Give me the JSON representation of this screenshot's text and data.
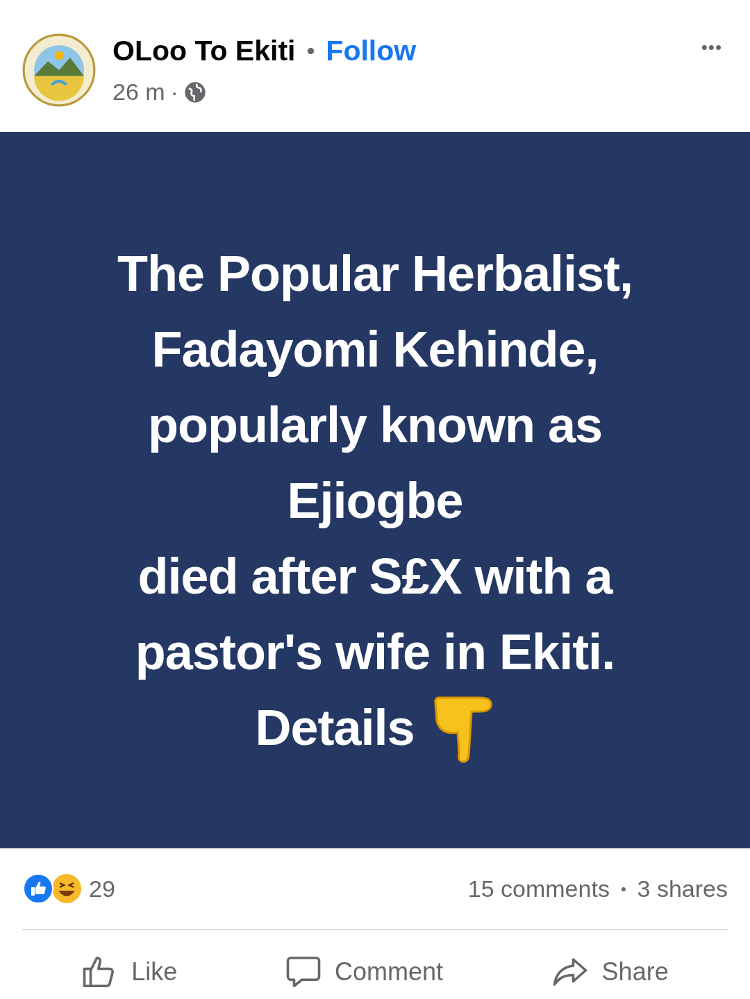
{
  "post": {
    "author": "OLoo To Ekiti",
    "separator": "•",
    "follow": "Follow",
    "time": "26 m",
    "time_separator": "·",
    "menu": "•••",
    "card_lines": [
      "The Popular Herbalist,",
      "Fadayomi Kehinde,",
      "popularly known as",
      "Ejiogbe",
      "died after S£X with a",
      "pastor's wife in Ekiti."
    ],
    "card_last_line": "Details",
    "reaction_count": "29",
    "comments": "15 comments",
    "stat_separator": "•",
    "shares": "3 shares",
    "actions": [
      {
        "kind": "like",
        "label": "Like"
      },
      {
        "kind": "comment",
        "label": "Comment"
      },
      {
        "kind": "share",
        "label": "Share"
      }
    ]
  }
}
